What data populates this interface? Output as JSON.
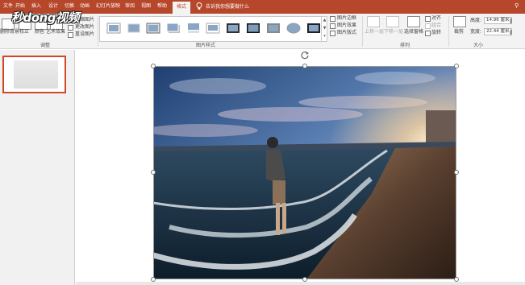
{
  "tabs": [
    "文件",
    "开始",
    "插入",
    "设计",
    "切换",
    "动画",
    "幻灯片放映",
    "审阅",
    "视图",
    "帮助",
    "格式"
  ],
  "tell_me": "告诉我你想要做什么",
  "watermark": "秒dong视频",
  "ribbon": {
    "remove_bg": "删除背景",
    "correct": "校正",
    "color": "颜色",
    "artistic": "艺术效果",
    "compress": "压缩图片",
    "change_pic": "更改图片",
    "reset_pic": "重设图片",
    "adjust_group": "调整",
    "styles_group": "图片样式",
    "border": "图片边框",
    "effects": "图片效果",
    "layout": "图片版式",
    "forward": "上移一层",
    "backward": "下移一层",
    "selection_pane": "选择窗格",
    "align": "对齐",
    "group": "组合",
    "rotate": "旋转",
    "arrange_group": "排列",
    "crop": "裁剪",
    "height_label": "高度:",
    "height_value": "14.96 厘米",
    "width_label": "宽度:",
    "width_value": "22.44 厘米",
    "size_group": "大小"
  },
  "slides": [
    {
      "number": "1"
    }
  ],
  "colors": {
    "accent": "#b7472a",
    "selection": "#d24726",
    "ribbon_bg": "#f3f3f3",
    "pane_bg": "#f1f1f1"
  }
}
